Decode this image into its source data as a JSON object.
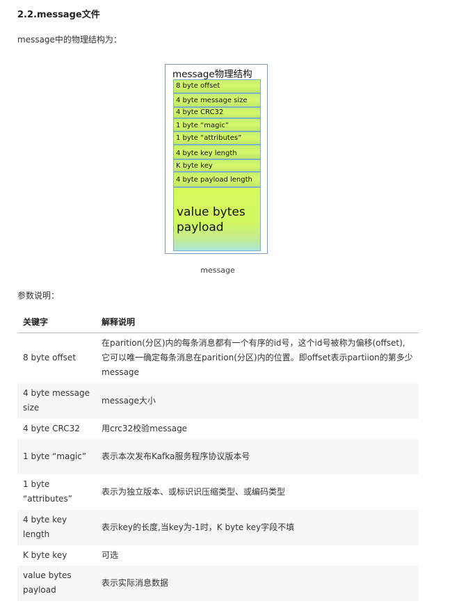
{
  "heading": "2.2.message文件",
  "intro": "message中的物理结构为：",
  "diagram": {
    "title": "message物理结构",
    "segments": [
      "8 byte offset",
      "4 byte message size",
      "4 byte CRC32",
      "1 byte “magic”",
      "1 byte “attributes”",
      "4 byte key length",
      "K byte key",
      "4 byte payload length",
      "value bytes payload"
    ],
    "caption": "message"
  },
  "params_label": "参数说明：",
  "table": {
    "headers": [
      "关键字",
      "解释说明"
    ],
    "rows": [
      [
        "8 byte offset",
        "在parition(分区)内的每条消息都有一个有序的id号，这个id号被称为偏移(offset),它可以唯一确定每条消息在parition(分区)内的位置。即offset表示partiion的第多少message"
      ],
      [
        "4 byte message size",
        "message大小"
      ],
      [
        "4 byte CRC32",
        "用crc32校验message"
      ],
      [
        "1 byte “magic”",
        "表示本次发布Kafka服务程序协议版本号"
      ],
      [
        "1 byte “attributes”",
        "表示为独立版本、或标识识压缩类型、或编码类型"
      ],
      [
        "4 byte key length",
        "表示key的长度,当key为-1时，K byte key字段不填"
      ],
      [
        "K byte key",
        "可选"
      ],
      [
        "value bytes payload",
        "表示实际消息数据"
      ]
    ]
  }
}
